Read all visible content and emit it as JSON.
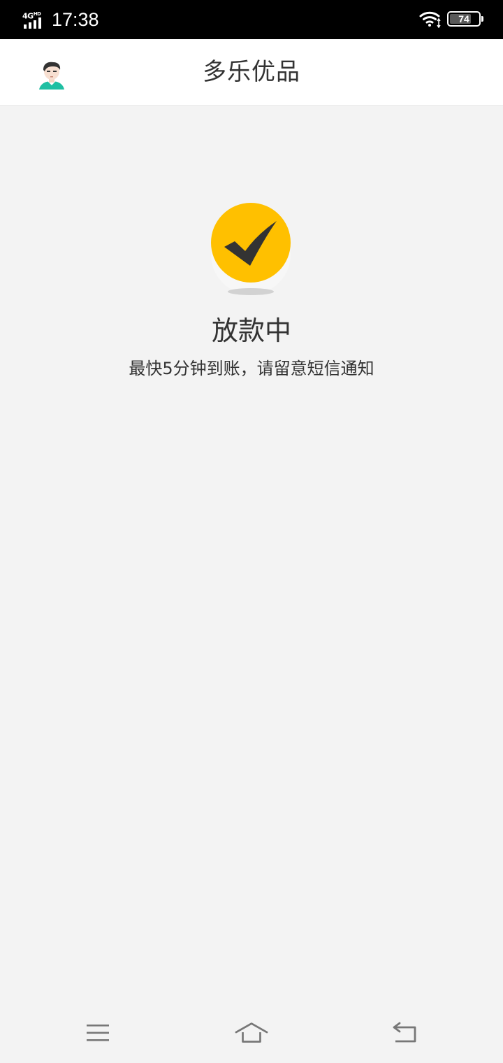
{
  "status_bar": {
    "network": "4G",
    "network_badge": "HD",
    "time": "17:38",
    "battery": "74",
    "battery_level": 0.74,
    "icons": [
      "signal-icon",
      "wifi-icon",
      "battery-icon"
    ]
  },
  "header": {
    "title": "多乐优品",
    "avatar_icon": "user-avatar-icon"
  },
  "result": {
    "icon": "check-circle-icon",
    "accent_color": "#FFC000",
    "title": "放款中",
    "subtitle": "最快5分钟到账，请留意短信通知"
  },
  "nav_bar": {
    "items": [
      "menu-icon",
      "home-icon",
      "back-icon"
    ]
  }
}
